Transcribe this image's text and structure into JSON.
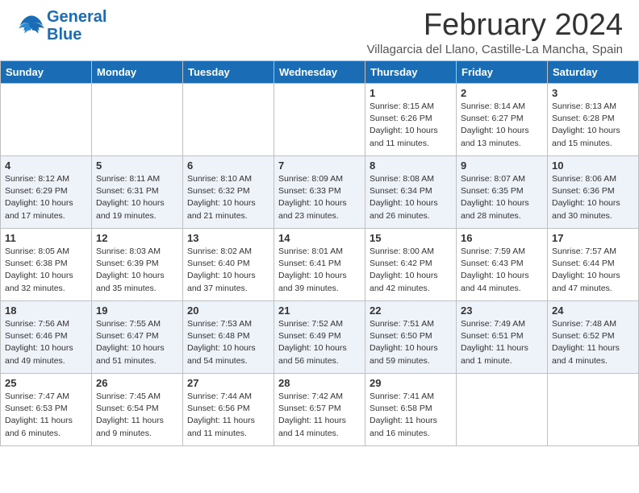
{
  "header": {
    "logo_line1": "General",
    "logo_line2": "Blue",
    "main_title": "February 2024",
    "subtitle": "Villagarcia del Llano, Castille-La Mancha, Spain"
  },
  "days_of_week": [
    "Sunday",
    "Monday",
    "Tuesday",
    "Wednesday",
    "Thursday",
    "Friday",
    "Saturday"
  ],
  "weeks": [
    {
      "days": [
        {
          "num": "",
          "info": ""
        },
        {
          "num": "",
          "info": ""
        },
        {
          "num": "",
          "info": ""
        },
        {
          "num": "",
          "info": ""
        },
        {
          "num": "1",
          "info": "Sunrise: 8:15 AM\nSunset: 6:26 PM\nDaylight: 10 hours\nand 11 minutes."
        },
        {
          "num": "2",
          "info": "Sunrise: 8:14 AM\nSunset: 6:27 PM\nDaylight: 10 hours\nand 13 minutes."
        },
        {
          "num": "3",
          "info": "Sunrise: 8:13 AM\nSunset: 6:28 PM\nDaylight: 10 hours\nand 15 minutes."
        }
      ]
    },
    {
      "days": [
        {
          "num": "4",
          "info": "Sunrise: 8:12 AM\nSunset: 6:29 PM\nDaylight: 10 hours\nand 17 minutes."
        },
        {
          "num": "5",
          "info": "Sunrise: 8:11 AM\nSunset: 6:31 PM\nDaylight: 10 hours\nand 19 minutes."
        },
        {
          "num": "6",
          "info": "Sunrise: 8:10 AM\nSunset: 6:32 PM\nDaylight: 10 hours\nand 21 minutes."
        },
        {
          "num": "7",
          "info": "Sunrise: 8:09 AM\nSunset: 6:33 PM\nDaylight: 10 hours\nand 23 minutes."
        },
        {
          "num": "8",
          "info": "Sunrise: 8:08 AM\nSunset: 6:34 PM\nDaylight: 10 hours\nand 26 minutes."
        },
        {
          "num": "9",
          "info": "Sunrise: 8:07 AM\nSunset: 6:35 PM\nDaylight: 10 hours\nand 28 minutes."
        },
        {
          "num": "10",
          "info": "Sunrise: 8:06 AM\nSunset: 6:36 PM\nDaylight: 10 hours\nand 30 minutes."
        }
      ]
    },
    {
      "days": [
        {
          "num": "11",
          "info": "Sunrise: 8:05 AM\nSunset: 6:38 PM\nDaylight: 10 hours\nand 32 minutes."
        },
        {
          "num": "12",
          "info": "Sunrise: 8:03 AM\nSunset: 6:39 PM\nDaylight: 10 hours\nand 35 minutes."
        },
        {
          "num": "13",
          "info": "Sunrise: 8:02 AM\nSunset: 6:40 PM\nDaylight: 10 hours\nand 37 minutes."
        },
        {
          "num": "14",
          "info": "Sunrise: 8:01 AM\nSunset: 6:41 PM\nDaylight: 10 hours\nand 39 minutes."
        },
        {
          "num": "15",
          "info": "Sunrise: 8:00 AM\nSunset: 6:42 PM\nDaylight: 10 hours\nand 42 minutes."
        },
        {
          "num": "16",
          "info": "Sunrise: 7:59 AM\nSunset: 6:43 PM\nDaylight: 10 hours\nand 44 minutes."
        },
        {
          "num": "17",
          "info": "Sunrise: 7:57 AM\nSunset: 6:44 PM\nDaylight: 10 hours\nand 47 minutes."
        }
      ]
    },
    {
      "days": [
        {
          "num": "18",
          "info": "Sunrise: 7:56 AM\nSunset: 6:46 PM\nDaylight: 10 hours\nand 49 minutes."
        },
        {
          "num": "19",
          "info": "Sunrise: 7:55 AM\nSunset: 6:47 PM\nDaylight: 10 hours\nand 51 minutes."
        },
        {
          "num": "20",
          "info": "Sunrise: 7:53 AM\nSunset: 6:48 PM\nDaylight: 10 hours\nand 54 minutes."
        },
        {
          "num": "21",
          "info": "Sunrise: 7:52 AM\nSunset: 6:49 PM\nDaylight: 10 hours\nand 56 minutes."
        },
        {
          "num": "22",
          "info": "Sunrise: 7:51 AM\nSunset: 6:50 PM\nDaylight: 10 hours\nand 59 minutes."
        },
        {
          "num": "23",
          "info": "Sunrise: 7:49 AM\nSunset: 6:51 PM\nDaylight: 11 hours\nand 1 minute."
        },
        {
          "num": "24",
          "info": "Sunrise: 7:48 AM\nSunset: 6:52 PM\nDaylight: 11 hours\nand 4 minutes."
        }
      ]
    },
    {
      "days": [
        {
          "num": "25",
          "info": "Sunrise: 7:47 AM\nSunset: 6:53 PM\nDaylight: 11 hours\nand 6 minutes."
        },
        {
          "num": "26",
          "info": "Sunrise: 7:45 AM\nSunset: 6:54 PM\nDaylight: 11 hours\nand 9 minutes."
        },
        {
          "num": "27",
          "info": "Sunrise: 7:44 AM\nSunset: 6:56 PM\nDaylight: 11 hours\nand 11 minutes."
        },
        {
          "num": "28",
          "info": "Sunrise: 7:42 AM\nSunset: 6:57 PM\nDaylight: 11 hours\nand 14 minutes."
        },
        {
          "num": "29",
          "info": "Sunrise: 7:41 AM\nSunset: 6:58 PM\nDaylight: 11 hours\nand 16 minutes."
        },
        {
          "num": "",
          "info": ""
        },
        {
          "num": "",
          "info": ""
        }
      ]
    }
  ]
}
